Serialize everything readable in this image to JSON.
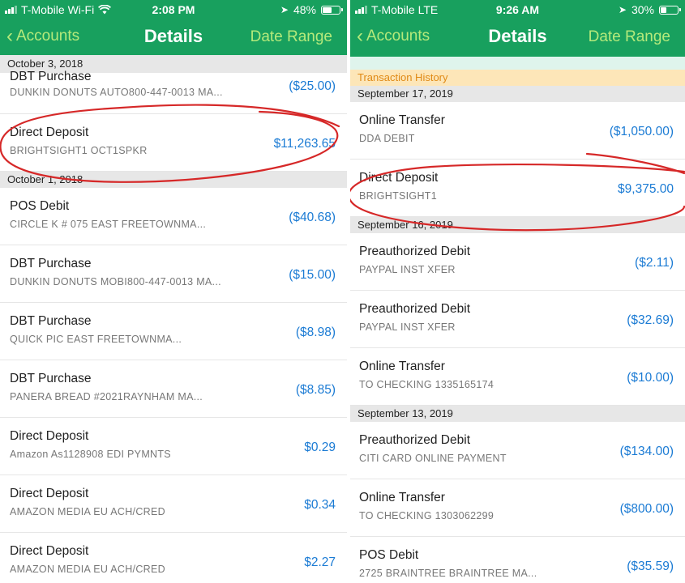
{
  "colors": {
    "header": "#18a05e",
    "nav_link": "#b5ea7b",
    "amount": "#1b7bd4",
    "annotation": "#d62828",
    "history_bg": "#fde6b8",
    "history_text": "#e08a16"
  },
  "icons": [
    "wifi-icon",
    "location-arrow-icon",
    "battery-icon",
    "chevron-left-icon",
    "signal-bars-icon"
  ],
  "left": {
    "status": {
      "carrier": "T-Mobile Wi-Fi",
      "time": "2:08 PM",
      "battery": "48%",
      "battery_level": 0.48
    },
    "nav": {
      "back": "Accounts",
      "title": "Details",
      "right": "Date Range"
    },
    "sections": [
      {
        "date": "October 3, 2018",
        "rows": [
          {
            "name": "DBT Purchase",
            "sub": "DUNKIN DONUTS AUTO800-447-0013 MA...",
            "amount": "($25.00)"
          },
          {
            "name": "Direct Deposit",
            "sub": "BRIGHTSIGHT1       OCT1SPKR",
            "amount": "$11,263.65"
          }
        ]
      },
      {
        "date": "October 1, 2018",
        "rows": [
          {
            "name": "POS Debit",
            "sub": "CIRCLE K # 075     EAST FREETOWNMA...",
            "amount": "($40.68)"
          },
          {
            "name": "DBT Purchase",
            "sub": "DUNKIN DONUTS MOBI800-447-0013 MA...",
            "amount": "($15.00)"
          },
          {
            "name": "DBT Purchase",
            "sub": "QUICK PIC          EAST FREETOWNMA...",
            "amount": "($8.98)"
          },
          {
            "name": "DBT Purchase",
            "sub": "PANERA BREAD #2021RAYNHAM       MA...",
            "amount": "($8.85)"
          },
          {
            "name": "Direct Deposit",
            "sub": "Amazon As1128908 EDI PYMNTS",
            "amount": "$0.29"
          },
          {
            "name": "Direct Deposit",
            "sub": "AMAZON MEDIA EU  ACH/CRED",
            "amount": "$0.34"
          },
          {
            "name": "Direct Deposit",
            "sub": "AMAZON MEDIA EU  ACH/CRED",
            "amount": "$2.27"
          }
        ]
      }
    ]
  },
  "right": {
    "status": {
      "carrier": "T-Mobile  LTE",
      "time": "9:26 AM",
      "battery": "30%",
      "battery_level": 0.3
    },
    "nav": {
      "back": "Accounts",
      "title": "Details",
      "right": "Date Range"
    },
    "history_label": "Transaction History",
    "sections": [
      {
        "date": "September 17, 2019",
        "rows": [
          {
            "name": "Online Transfer",
            "sub": "DDA DEBIT",
            "amount": "($1,050.00)"
          },
          {
            "name": "Direct Deposit",
            "sub": "BRIGHTSIGHT1",
            "amount": "$9,375.00"
          }
        ]
      },
      {
        "date": "September 16, 2019",
        "rows": [
          {
            "name": "Preauthorized Debit",
            "sub": "PAYPAL          INST XFER",
            "amount": "($2.11)"
          },
          {
            "name": "Preauthorized Debit",
            "sub": "PAYPAL          INST XFER",
            "amount": "($32.69)"
          },
          {
            "name": "Online Transfer",
            "sub": "TO CHECKING       1335165174",
            "amount": "($10.00)"
          }
        ]
      },
      {
        "date": "September 13, 2019",
        "rows": [
          {
            "name": "Preauthorized Debit",
            "sub": "CITI CARD ONLINE PAYMENT",
            "amount": "($134.00)"
          },
          {
            "name": "Online Transfer",
            "sub": "TO CHECKING       1303062299",
            "amount": "($800.00)"
          },
          {
            "name": "POS Debit",
            "sub": "2725 BRAINTREE      BRAINTREE     MA...",
            "amount": "($35.59)"
          }
        ]
      }
    ]
  }
}
